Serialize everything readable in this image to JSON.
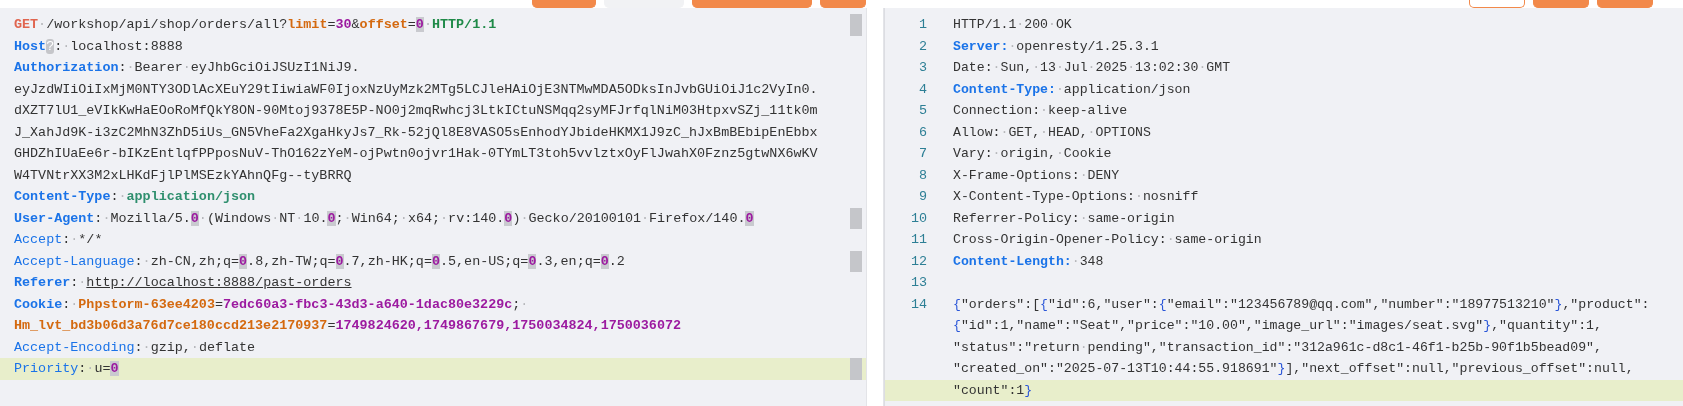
{
  "request": {
    "rows": [
      {
        "selected": false,
        "marked": true,
        "segments": [
          {
            "kind": "method",
            "text": "GET"
          },
          {
            "kind": "ws",
            "text": "·"
          },
          {
            "kind": "plain",
            "text": "/workshop/api/shop/orders/all?"
          },
          {
            "kind": "param",
            "text": "limit"
          },
          {
            "kind": "plain",
            "text": "="
          },
          {
            "kind": "num",
            "text": "30"
          },
          {
            "kind": "plain",
            "text": "&"
          },
          {
            "kind": "param",
            "text": "offset"
          },
          {
            "kind": "plain",
            "text": "="
          },
          {
            "kind": "match",
            "text": "0"
          },
          {
            "kind": "ws",
            "text": "·"
          },
          {
            "kind": "proto",
            "text": "HTTP/1.1"
          }
        ]
      },
      {
        "selected": false,
        "marked": false,
        "segments": [
          {
            "kind": "key",
            "text": "Host"
          },
          {
            "kind": "badge",
            "text": "?"
          },
          {
            "kind": "plain",
            "text": ":"
          },
          {
            "kind": "ws",
            "text": "·"
          },
          {
            "kind": "plain",
            "text": "localhost:8888"
          }
        ]
      },
      {
        "selected": false,
        "marked": false,
        "segments": [
          {
            "kind": "key",
            "text": "Authorization"
          },
          {
            "kind": "plain",
            "text": ":"
          },
          {
            "kind": "ws",
            "text": "·"
          },
          {
            "kind": "plain",
            "text": "Bearer"
          },
          {
            "kind": "ws",
            "text": "·"
          },
          {
            "kind": "plain",
            "text": "eyJhbGciOiJSUzI1NiJ9."
          }
        ]
      },
      {
        "selected": false,
        "marked": false,
        "segments": [
          {
            "kind": "plain",
            "text": "eyJzdWIiOiIxMjM0NTY3ODlAcXEuY29tIiwiaWF0IjoxNzUyMzk2MTg5LCJleHAiOjE3NTMwMDA5ODksInJvbGUiOiJ1c2VyIn0."
          }
        ]
      },
      {
        "selected": false,
        "marked": false,
        "segments": [
          {
            "kind": "plain",
            "text": "dXZT7lU1_eVIkKwHaEOoRoMfQkY8ON-90Mtoj9378E5P-NO0j2mqRwhcj3LtkICtuNSMqq2syMFJrfqlNiM03HtpxvSZj_11tk0m"
          }
        ]
      },
      {
        "selected": false,
        "marked": false,
        "segments": [
          {
            "kind": "plain",
            "text": "J_XahJd9K-i3zC2MhN3ZhD5iUs_GN5VheFa2XgaHkyJs7_Rk-52jQl8E8VASO5sEnhodYJbideHKMX1J9zC_hJxBmBEbipEnEbbx"
          }
        ]
      },
      {
        "selected": false,
        "marked": false,
        "segments": [
          {
            "kind": "plain",
            "text": "GHDZhIUaEe6r-bIKzEntlqfPPposNuV-ThO162zYeM-ojPwtn0ojvr1Hak-0TYmLT3toh5vvlztxOyFlJwahX0Fznz5gtwNX6wKV"
          }
        ]
      },
      {
        "selected": false,
        "marked": false,
        "segments": [
          {
            "kind": "plain",
            "text": "W4TVNtrXX3M2xLHKdFjlPlMSEzkYAhnQFg--tyBRRQ"
          }
        ]
      },
      {
        "selected": false,
        "marked": false,
        "segments": [
          {
            "kind": "key",
            "text": "Content-Type"
          },
          {
            "kind": "plain",
            "text": ":"
          },
          {
            "kind": "ws",
            "text": "·"
          },
          {
            "kind": "json",
            "text": "application/json"
          }
        ]
      },
      {
        "selected": false,
        "marked": true,
        "segments": [
          {
            "kind": "key",
            "text": "User-Agent"
          },
          {
            "kind": "plain",
            "text": ":"
          },
          {
            "kind": "ws",
            "text": "·"
          },
          {
            "kind": "plain",
            "text": "Mozilla/5."
          },
          {
            "kind": "match",
            "text": "0"
          },
          {
            "kind": "ws",
            "text": "·"
          },
          {
            "kind": "plain",
            "text": "(Windows"
          },
          {
            "kind": "ws",
            "text": "·"
          },
          {
            "kind": "plain",
            "text": "NT"
          },
          {
            "kind": "ws",
            "text": "·"
          },
          {
            "kind": "plain",
            "text": "10."
          },
          {
            "kind": "match",
            "text": "0"
          },
          {
            "kind": "plain",
            "text": ";"
          },
          {
            "kind": "ws",
            "text": "·"
          },
          {
            "kind": "plain",
            "text": "Win64;"
          },
          {
            "kind": "ws",
            "text": "·"
          },
          {
            "kind": "plain",
            "text": "x64;"
          },
          {
            "kind": "ws",
            "text": "·"
          },
          {
            "kind": "plain",
            "text": "rv:140."
          },
          {
            "kind": "match",
            "text": "0"
          },
          {
            "kind": "plain",
            "text": ")"
          },
          {
            "kind": "ws",
            "text": "·"
          },
          {
            "kind": "plain",
            "text": "Gecko/20100101"
          },
          {
            "kind": "ws",
            "text": "·"
          },
          {
            "kind": "plain",
            "text": "Firefox/140."
          },
          {
            "kind": "match",
            "text": "0"
          }
        ]
      },
      {
        "selected": false,
        "marked": false,
        "segments": [
          {
            "kind": "keyPlain",
            "text": "Accept"
          },
          {
            "kind": "plain",
            "text": ":"
          },
          {
            "kind": "ws",
            "text": "·"
          },
          {
            "kind": "plain",
            "text": "*/*"
          }
        ]
      },
      {
        "selected": false,
        "marked": true,
        "segments": [
          {
            "kind": "keyPlain",
            "text": "Accept-Language"
          },
          {
            "kind": "plain",
            "text": ":"
          },
          {
            "kind": "ws",
            "text": "·"
          },
          {
            "kind": "plain",
            "text": "zh-CN,zh;q="
          },
          {
            "kind": "match",
            "text": "0"
          },
          {
            "kind": "plain",
            "text": ".8,zh-TW;q="
          },
          {
            "kind": "match",
            "text": "0"
          },
          {
            "kind": "plain",
            "text": ".7,zh-HK;q="
          },
          {
            "kind": "match",
            "text": "0"
          },
          {
            "kind": "plain",
            "text": ".5,en-US;q="
          },
          {
            "kind": "match",
            "text": "0"
          },
          {
            "kind": "plain",
            "text": ".3,en;q="
          },
          {
            "kind": "match",
            "text": "0"
          },
          {
            "kind": "plain",
            "text": ".2"
          }
        ]
      },
      {
        "selected": false,
        "marked": false,
        "segments": [
          {
            "kind": "key",
            "text": "Referer"
          },
          {
            "kind": "plain",
            "text": ":"
          },
          {
            "kind": "ws",
            "text": "·"
          },
          {
            "kind": "link",
            "text": "http://localhost:8888/past-orders"
          }
        ]
      },
      {
        "selected": false,
        "marked": false,
        "segments": [
          {
            "kind": "key",
            "text": "Cookie"
          },
          {
            "kind": "plain",
            "text": ":"
          },
          {
            "kind": "ws",
            "text": "·"
          },
          {
            "kind": "cookieName",
            "text": "Phpstorm-63ee4203"
          },
          {
            "kind": "plain",
            "text": "="
          },
          {
            "kind": "cookieVal",
            "text": "7edc60a3-fbc3-43d3-a640-1dac80e3229c"
          },
          {
            "kind": "plain",
            "text": ";"
          },
          {
            "kind": "ws",
            "text": "·"
          }
        ]
      },
      {
        "selected": false,
        "marked": false,
        "segments": [
          {
            "kind": "cookieName",
            "text": "Hm_lvt_bd3b06d3a76d7ce180ccd213e2170937"
          },
          {
            "kind": "plain",
            "text": "="
          },
          {
            "kind": "cookieVal",
            "text": "1749824620,1749867679,1750034824,1750036072"
          }
        ]
      },
      {
        "selected": false,
        "marked": false,
        "segments": [
          {
            "kind": "keyPlain",
            "text": "Accept-Encoding"
          },
          {
            "kind": "plain",
            "text": ":"
          },
          {
            "kind": "ws",
            "text": "·"
          },
          {
            "kind": "plain",
            "text": "gzip,"
          },
          {
            "kind": "ws",
            "text": "·"
          },
          {
            "kind": "plain",
            "text": "deflate"
          }
        ]
      },
      {
        "selected": true,
        "marked": true,
        "segments": [
          {
            "kind": "keyPlain",
            "text": "Priority"
          },
          {
            "kind": "plain",
            "text": ":"
          },
          {
            "kind": "ws",
            "text": "·"
          },
          {
            "kind": "plain",
            "text": "u="
          },
          {
            "kind": "match",
            "text": "0"
          }
        ]
      }
    ]
  },
  "response": {
    "lines": [
      {
        "number": "1",
        "rows": [
          {
            "selected": false,
            "segments": [
              {
                "kind": "plain",
                "text": "HTTP/1.1"
              },
              {
                "kind": "ws",
                "text": "·"
              },
              {
                "kind": "plain",
                "text": "200"
              },
              {
                "kind": "ws",
                "text": "·"
              },
              {
                "kind": "plain",
                "text": "OK"
              }
            ]
          }
        ]
      },
      {
        "number": "2",
        "rows": [
          {
            "selected": false,
            "segments": [
              {
                "kind": "key",
                "text": "Server:"
              },
              {
                "kind": "ws",
                "text": "·"
              },
              {
                "kind": "plain",
                "text": "openresty/1.25.3.1"
              }
            ]
          }
        ]
      },
      {
        "number": "3",
        "rows": [
          {
            "selected": false,
            "segments": [
              {
                "kind": "plain",
                "text": "Date:"
              },
              {
                "kind": "ws",
                "text": "·"
              },
              {
                "kind": "plain",
                "text": "Sun,"
              },
              {
                "kind": "ws",
                "text": "·"
              },
              {
                "kind": "plain",
                "text": "13"
              },
              {
                "kind": "ws",
                "text": "·"
              },
              {
                "kind": "plain",
                "text": "Jul"
              },
              {
                "kind": "ws",
                "text": "·"
              },
              {
                "kind": "plain",
                "text": "2025"
              },
              {
                "kind": "ws",
                "text": "·"
              },
              {
                "kind": "plain",
                "text": "13:02:30"
              },
              {
                "kind": "ws",
                "text": "·"
              },
              {
                "kind": "plain",
                "text": "GMT"
              }
            ]
          }
        ]
      },
      {
        "number": "4",
        "rows": [
          {
            "selected": false,
            "segments": [
              {
                "kind": "key",
                "text": "Content-Type:"
              },
              {
                "kind": "ws",
                "text": "·"
              },
              {
                "kind": "plain",
                "text": "application/json"
              }
            ]
          }
        ]
      },
      {
        "number": "5",
        "rows": [
          {
            "selected": false,
            "segments": [
              {
                "kind": "plain",
                "text": "Connection:"
              },
              {
                "kind": "ws",
                "text": "·"
              },
              {
                "kind": "plain",
                "text": "keep-alive"
              }
            ]
          }
        ]
      },
      {
        "number": "6",
        "rows": [
          {
            "selected": false,
            "segments": [
              {
                "kind": "plain",
                "text": "Allow:"
              },
              {
                "kind": "ws",
                "text": "·"
              },
              {
                "kind": "plain",
                "text": "GET,"
              },
              {
                "kind": "ws",
                "text": "·"
              },
              {
                "kind": "plain",
                "text": "HEAD,"
              },
              {
                "kind": "ws",
                "text": "·"
              },
              {
                "kind": "plain",
                "text": "OPTIONS"
              }
            ]
          }
        ]
      },
      {
        "number": "7",
        "rows": [
          {
            "selected": false,
            "segments": [
              {
                "kind": "plain",
                "text": "Vary:"
              },
              {
                "kind": "ws",
                "text": "·"
              },
              {
                "kind": "plain",
                "text": "origin,"
              },
              {
                "kind": "ws",
                "text": "·"
              },
              {
                "kind": "plain",
                "text": "Cookie"
              }
            ]
          }
        ]
      },
      {
        "number": "8",
        "rows": [
          {
            "selected": false,
            "segments": [
              {
                "kind": "plain",
                "text": "X-Frame-Options:"
              },
              {
                "kind": "ws",
                "text": "·"
              },
              {
                "kind": "plain",
                "text": "DENY"
              }
            ]
          }
        ]
      },
      {
        "number": "9",
        "rows": [
          {
            "selected": false,
            "segments": [
              {
                "kind": "plain",
                "text": "X-Content-Type-Options:"
              },
              {
                "kind": "ws",
                "text": "·"
              },
              {
                "kind": "plain",
                "text": "nosniff"
              }
            ]
          }
        ]
      },
      {
        "number": "10",
        "rows": [
          {
            "selected": false,
            "segments": [
              {
                "kind": "plain",
                "text": "Referrer-Policy:"
              },
              {
                "kind": "ws",
                "text": "·"
              },
              {
                "kind": "plain",
                "text": "same-origin"
              }
            ]
          }
        ]
      },
      {
        "number": "11",
        "rows": [
          {
            "selected": false,
            "segments": [
              {
                "kind": "plain",
                "text": "Cross-Origin-Opener-Policy:"
              },
              {
                "kind": "ws",
                "text": "·"
              },
              {
                "kind": "plain",
                "text": "same-origin"
              }
            ]
          }
        ]
      },
      {
        "number": "12",
        "rows": [
          {
            "selected": false,
            "segments": [
              {
                "kind": "key",
                "text": "Content-Length:"
              },
              {
                "kind": "ws",
                "text": "·"
              },
              {
                "kind": "plain",
                "text": "348"
              }
            ]
          }
        ]
      },
      {
        "number": "13",
        "rows": [
          {
            "selected": false,
            "segments": []
          }
        ]
      },
      {
        "number": "14",
        "rows": [
          {
            "selected": false,
            "segments": [
              {
                "kind": "brace",
                "text": "{"
              },
              {
                "kind": "plain",
                "text": "\"orders\":["
              },
              {
                "kind": "brace",
                "text": "{"
              },
              {
                "kind": "plain",
                "text": "\"id\":6,\"user\":"
              },
              {
                "kind": "brace",
                "text": "{"
              },
              {
                "kind": "plain",
                "text": "\"email\":\"123456789@qq.com\",\"number\":\"18977513210\""
              },
              {
                "kind": "brace",
                "text": "}"
              },
              {
                "kind": "plain",
                "text": ",\"product\":"
              }
            ]
          },
          {
            "selected": false,
            "segments": [
              {
                "kind": "brace",
                "text": "{"
              },
              {
                "kind": "plain",
                "text": "\"id\":1,\"name\":\"Seat\",\"price\":\"10.00\",\"image_url\":\"images/seat.svg\""
              },
              {
                "kind": "brace",
                "text": "}"
              },
              {
                "kind": "plain",
                "text": ",\"quantity\":1,"
              }
            ]
          },
          {
            "selected": false,
            "segments": [
              {
                "kind": "plain",
                "text": "\"status\":\"return"
              },
              {
                "kind": "ws",
                "text": "·"
              },
              {
                "kind": "plain",
                "text": "pending\",\"transaction_id\":\"312a961c-d8c1-46f1-b25b-90f1b5bead09\","
              }
            ]
          },
          {
            "selected": false,
            "segments": [
              {
                "kind": "plain",
                "text": "\"created_on\":\"2025-07-13T10:44:55.918691\""
              },
              {
                "kind": "brace",
                "text": "}"
              },
              {
                "kind": "plain",
                "text": "],\"next_offset\":null,\"previous_offset\":null,"
              }
            ]
          },
          {
            "selected": true,
            "segments": [
              {
                "kind": "plain",
                "text": "\"count\":1"
              },
              {
                "kind": "brace",
                "text": "}"
              }
            ]
          }
        ]
      }
    ]
  }
}
